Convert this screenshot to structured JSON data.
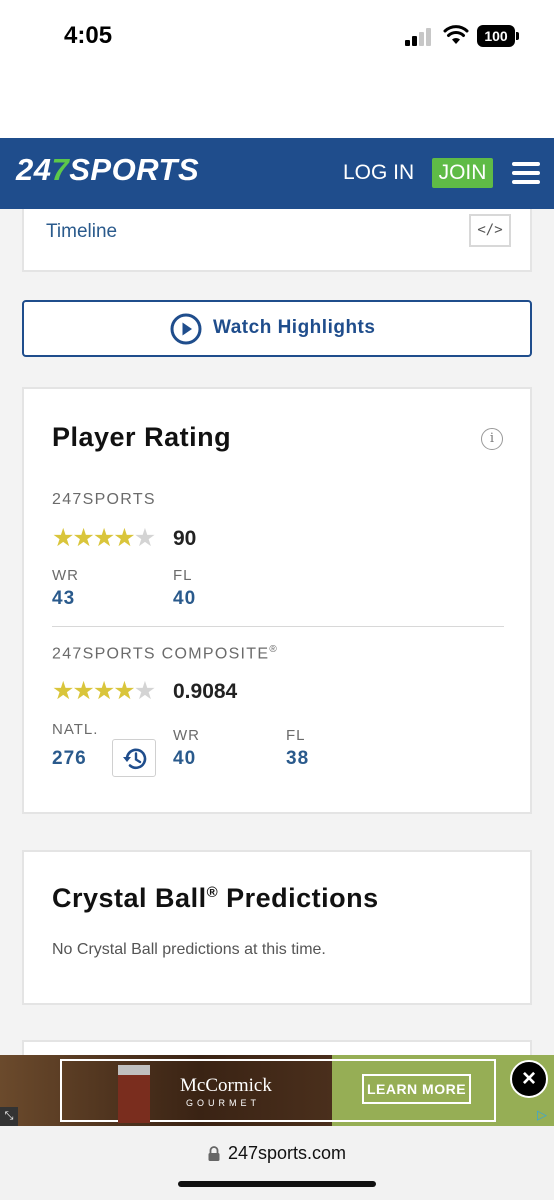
{
  "status_bar": {
    "time": "4:05",
    "battery": "100",
    "icons": [
      "signal-icon",
      "wifi-icon",
      "battery-icon"
    ]
  },
  "header": {
    "logo_prefix": "24",
    "logo_seven": "7",
    "logo_suffix": "SPORTS",
    "login_label": "LOG IN",
    "join_label": "JOIN",
    "menu_icon": "hamburger-menu-icon",
    "brand_color": "#1f4d8c",
    "join_color": "#5fbb46"
  },
  "timeline": {
    "label": "Timeline",
    "embed_icon": "</>"
  },
  "highlights": {
    "label": "Watch Highlights",
    "icon": "play-circle-icon"
  },
  "player_rating": {
    "title": "Player Rating",
    "info_icon": "i",
    "sports247": {
      "label": "247SPORTS",
      "stars": 4,
      "max_stars": 5,
      "rating": "90",
      "position_label": "WR",
      "position_value": "43",
      "state_label": "FL",
      "state_value": "40"
    },
    "composite": {
      "label": "247SPORTS COMPOSITE",
      "registered": "®",
      "stars": 4,
      "max_stars": 5,
      "rating": "0.9084",
      "natl_label": "NATL.",
      "natl_value": "276",
      "position_label": "WR",
      "position_value": "40",
      "state_label": "FL",
      "state_value": "38",
      "history_icon": "history-icon"
    }
  },
  "crystal_ball": {
    "title_main": "Crystal Ball",
    "title_reg": "®",
    "title_rest": " Predictions",
    "empty_text": "No Crystal Ball predictions at this time."
  },
  "ad": {
    "brand": "McCormick",
    "tagline": "GOURMET",
    "cta": "LEARN MORE",
    "close_icon": "close-icon",
    "close_glyph": "×"
  },
  "url_bar": {
    "url": "247sports.com"
  }
}
